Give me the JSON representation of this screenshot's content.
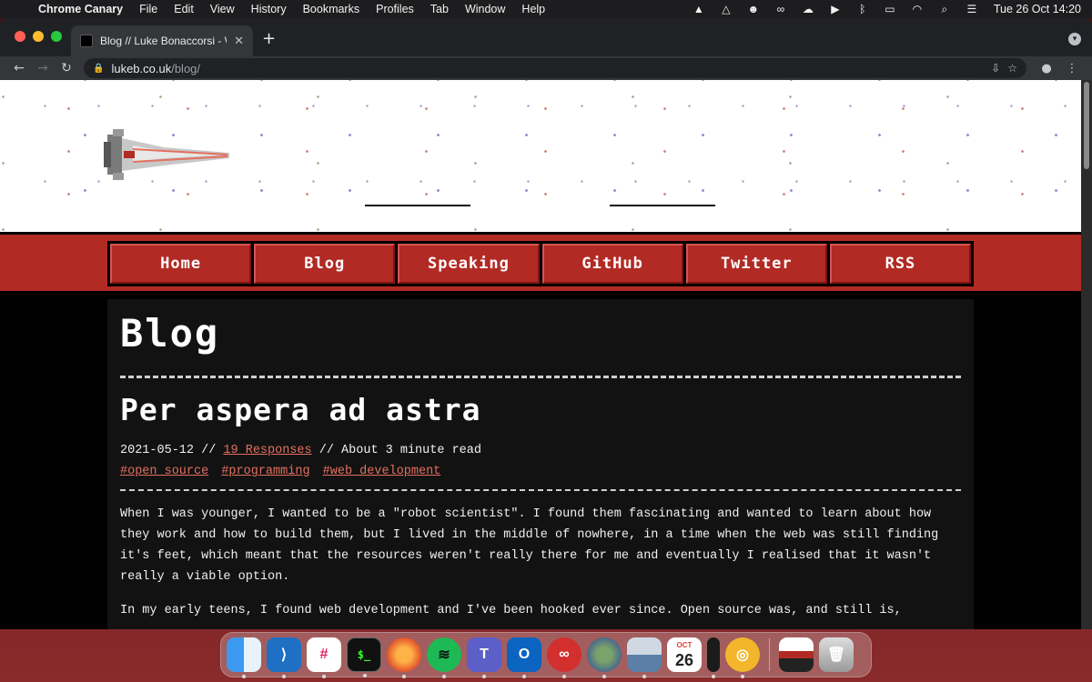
{
  "menubar": {
    "app": "Chrome Canary",
    "items": [
      "File",
      "Edit",
      "View",
      "History",
      "Bookmarks",
      "Profiles",
      "Tab",
      "Window",
      "Help"
    ],
    "clock": "Tue 26 Oct  14:20"
  },
  "browser": {
    "tab_title": "Blog // Luke Bonaccorsi - Web",
    "url_host": "lukeb.co.uk",
    "url_path": "/blog/"
  },
  "site": {
    "nav": [
      "Home",
      "Blog",
      "Speaking",
      "GitHub",
      "Twitter",
      "RSS"
    ],
    "page_title": "Blog"
  },
  "post": {
    "title": "Per aspera ad astra",
    "date": "2021-05-12",
    "sep1": " // ",
    "responses": "19 Responses",
    "sep2": " // About 3 minute read",
    "tags": [
      "#open source",
      "#programming",
      "#web development"
    ],
    "paragraphs": [
      "When I was younger, I wanted to be a \"robot scientist\". I found them fascinating and wanted to learn about how they work and how to build them, but I lived in the middle of nowhere, in a time when the web was still finding it's feet, which meant that the resources weren't really there for me and eventually I realised that it wasn't really a viable option.",
      "In my early teens, I found web development and I've been hooked ever since. Open source was, and still is,"
    ]
  },
  "dock": {
    "calendar_month": "OCT",
    "calendar_day": "26"
  },
  "colors": {
    "accent": "#b22a24",
    "link": "#e4705f",
    "content_bg": "#121212"
  }
}
